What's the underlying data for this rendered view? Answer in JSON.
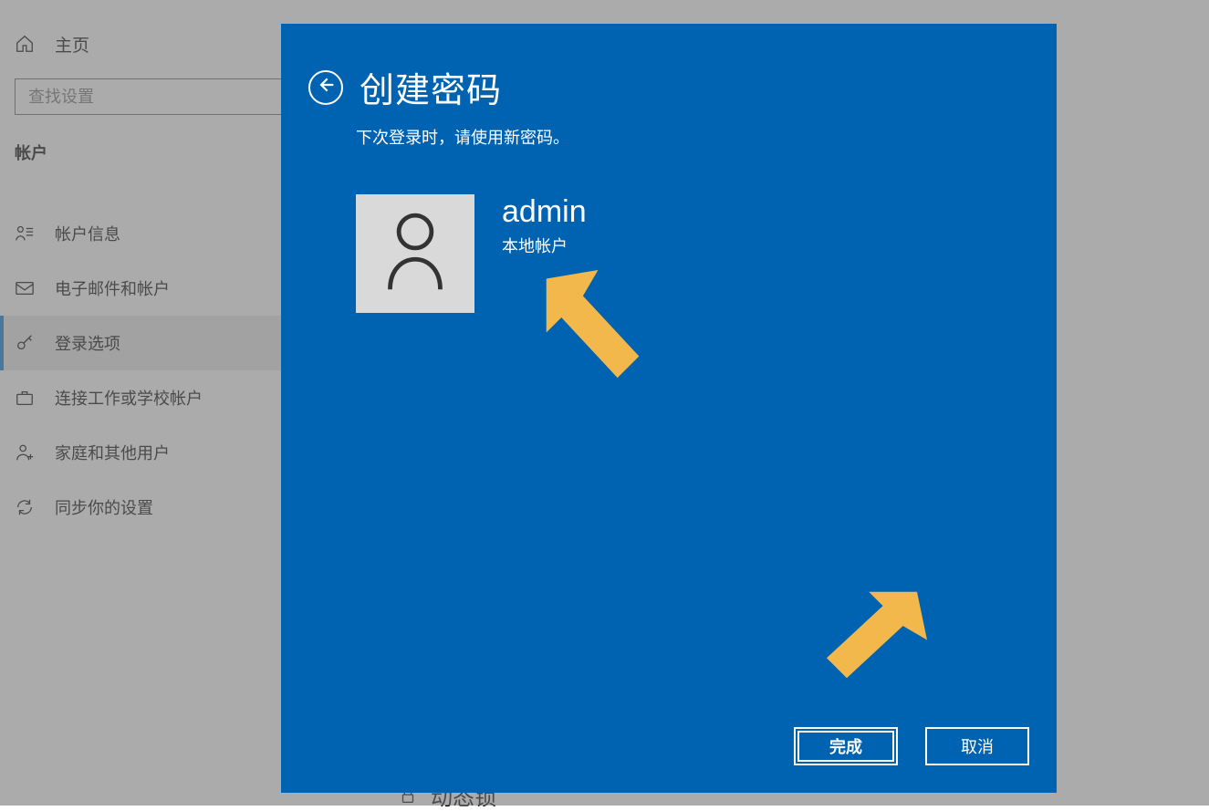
{
  "sidebar": {
    "home_label": "主页",
    "search_placeholder": "查找设置",
    "section_title": "帐户",
    "items": [
      {
        "label": "帐户信息"
      },
      {
        "label": "电子邮件和帐户"
      },
      {
        "label": "登录选项"
      },
      {
        "label": "连接工作或学校帐户"
      },
      {
        "label": "家庭和其他用户"
      },
      {
        "label": "同步你的设置"
      }
    ]
  },
  "content": {
    "dynamic_lock_label": "动态锁"
  },
  "modal": {
    "title": "创建密码",
    "subtitle": "下次登录时，请使用新密码。",
    "user_name": "admin",
    "account_type": "本地帐户",
    "finish_label": "完成",
    "cancel_label": "取消"
  }
}
